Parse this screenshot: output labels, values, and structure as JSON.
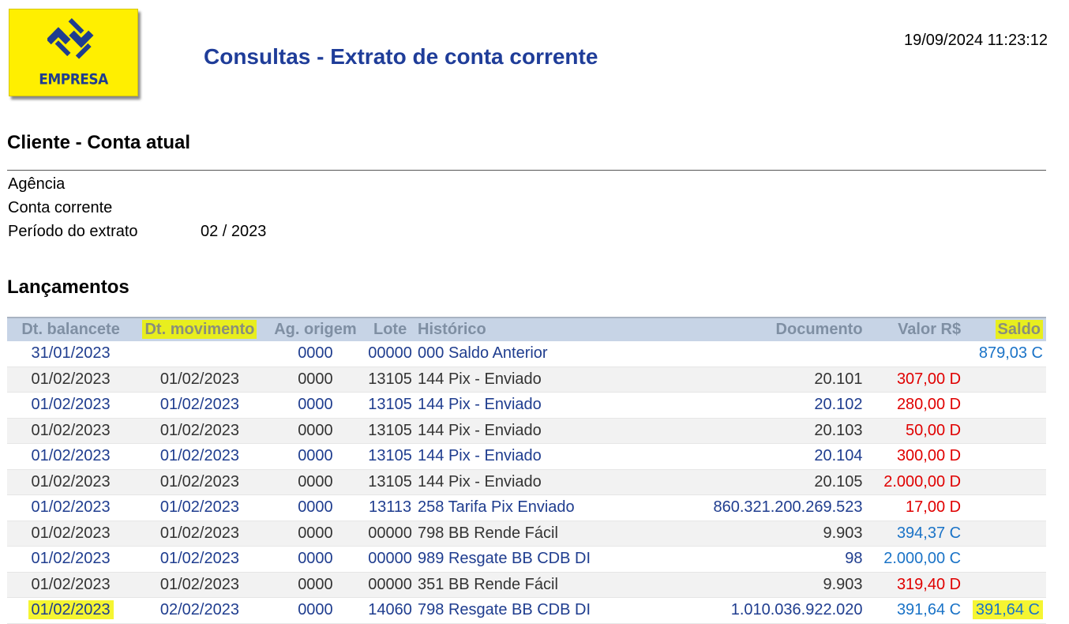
{
  "header": {
    "logo_text": "EMPRESA",
    "title": "Consultas - Extrato de conta corrente",
    "datetime": "19/09/2024 11:23:12"
  },
  "client": {
    "heading": "Cliente - Conta atual",
    "agencia_label": "Agência",
    "conta_label": "Conta corrente",
    "periodo_label": "Período do extrato",
    "periodo_value": "02 / 2023"
  },
  "lancamentos": {
    "heading": "Lançamentos",
    "columns": [
      "Dt. balancete",
      "Dt. movimento",
      "Ag. origem",
      "Lote",
      "Histórico",
      "Documento",
      "Valor R$",
      "Saldo"
    ],
    "rows": [
      {
        "dt_balancete": "31/01/2023",
        "dt_movimento": "",
        "ag_origem": "0000",
        "lote": "00000",
        "historico": "000 Saldo Anterior",
        "documento": "",
        "valor": "",
        "saldo": "879,03 C"
      },
      {
        "dt_balancete": "01/02/2023",
        "dt_movimento": "01/02/2023",
        "ag_origem": "0000",
        "lote": "13105",
        "historico": "144 Pix - Enviado",
        "documento": "20.101",
        "valor": "307,00 D",
        "saldo": ""
      },
      {
        "dt_balancete": "01/02/2023",
        "dt_movimento": "01/02/2023",
        "ag_origem": "0000",
        "lote": "13105",
        "historico": "144 Pix - Enviado",
        "documento": "20.102",
        "valor": "280,00 D",
        "saldo": ""
      },
      {
        "dt_balancete": "01/02/2023",
        "dt_movimento": "01/02/2023",
        "ag_origem": "0000",
        "lote": "13105",
        "historico": "144 Pix - Enviado",
        "documento": "20.103",
        "valor": "50,00 D",
        "saldo": ""
      },
      {
        "dt_balancete": "01/02/2023",
        "dt_movimento": "01/02/2023",
        "ag_origem": "0000",
        "lote": "13105",
        "historico": "144 Pix - Enviado",
        "documento": "20.104",
        "valor": "300,00 D",
        "saldo": ""
      },
      {
        "dt_balancete": "01/02/2023",
        "dt_movimento": "01/02/2023",
        "ag_origem": "0000",
        "lote": "13105",
        "historico": "144 Pix - Enviado",
        "documento": "20.105",
        "valor": "2.000,00 D",
        "saldo": ""
      },
      {
        "dt_balancete": "01/02/2023",
        "dt_movimento": "01/02/2023",
        "ag_origem": "0000",
        "lote": "13113",
        "historico": "258 Tarifa Pix Enviado",
        "documento": "860.321.200.269.523",
        "valor": "17,00 D",
        "saldo": ""
      },
      {
        "dt_balancete": "01/02/2023",
        "dt_movimento": "01/02/2023",
        "ag_origem": "0000",
        "lote": "00000",
        "historico": "798 BB Rende Fácil",
        "documento": "9.903",
        "valor": "394,37 C",
        "saldo": ""
      },
      {
        "dt_balancete": "01/02/2023",
        "dt_movimento": "01/02/2023",
        "ag_origem": "0000",
        "lote": "00000",
        "historico": "989 Resgate BB CDB DI",
        "documento": "98",
        "valor": "2.000,00 C",
        "saldo": ""
      },
      {
        "dt_balancete": "01/02/2023",
        "dt_movimento": "01/02/2023",
        "ag_origem": "0000",
        "lote": "00000",
        "historico": "351 BB Rende Fácil",
        "documento": "9.903",
        "valor": "319,40 D",
        "saldo": ""
      },
      {
        "dt_balancete": "01/02/2023",
        "dt_movimento": "02/02/2023",
        "ag_origem": "0000",
        "lote": "14060",
        "historico": "798 Resgate BB CDB DI",
        "documento": "1.010.036.922.020",
        "valor": "391,64 C",
        "saldo": "391,64 C"
      }
    ]
  },
  "colors": {
    "title_blue": "#1f3d99",
    "logo_yellow": "#ffef00",
    "debit_red": "#e00000",
    "credit_blue": "#1a73c7",
    "header_bg": "#c7d4e6",
    "highlight_yellow": "#f5f532"
  },
  "icons": {
    "logo": "banco-do-brasil-logo-icon"
  }
}
